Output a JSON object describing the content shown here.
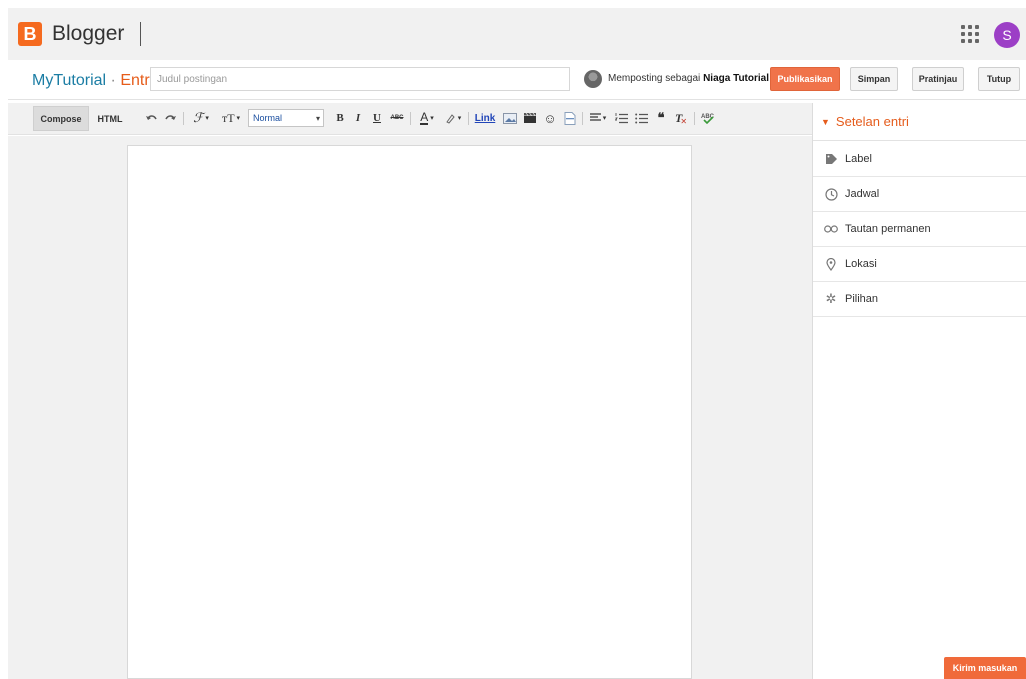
{
  "header": {
    "logo_letter": "B",
    "brand": "Blogger",
    "profile_initial": "S",
    "apps_icon": "apps-grid-icon"
  },
  "post": {
    "blog_name": "MyTutorial",
    "separator": "·",
    "section": "Entri",
    "title_placeholder": "Judul postingan",
    "title_value": "",
    "posting_as_prefix": "Memposting sebagai",
    "posting_as_name": "Niaga Tutorial"
  },
  "actions": {
    "publish": "Publikasikan",
    "save": "Simpan",
    "preview": "Pratinjau",
    "close": "Tutup"
  },
  "toolbar": {
    "compose": "Compose",
    "html": "HTML",
    "font_size": "Normal",
    "link": "Link",
    "undo_icon": "undo-icon",
    "redo_icon": "redo-icon"
  },
  "side": {
    "header": "Setelan entri",
    "items": [
      {
        "label": "Label",
        "icon": "tag-icon"
      },
      {
        "label": "Jadwal",
        "icon": "clock-icon"
      },
      {
        "label": "Tautan permanen",
        "icon": "link-icon"
      },
      {
        "label": "Lokasi",
        "icon": "location-pin-icon"
      },
      {
        "label": "Pilihan",
        "icon": "gear-icon"
      }
    ]
  },
  "feedback": "Kirim masukan",
  "colors": {
    "brand_orange": "#f56a1f",
    "publish_button": "#f0734a",
    "blog_name_blue": "#1b7da4",
    "side_header_orange": "#e55c1c",
    "profile_purple": "#9c3fc6"
  }
}
